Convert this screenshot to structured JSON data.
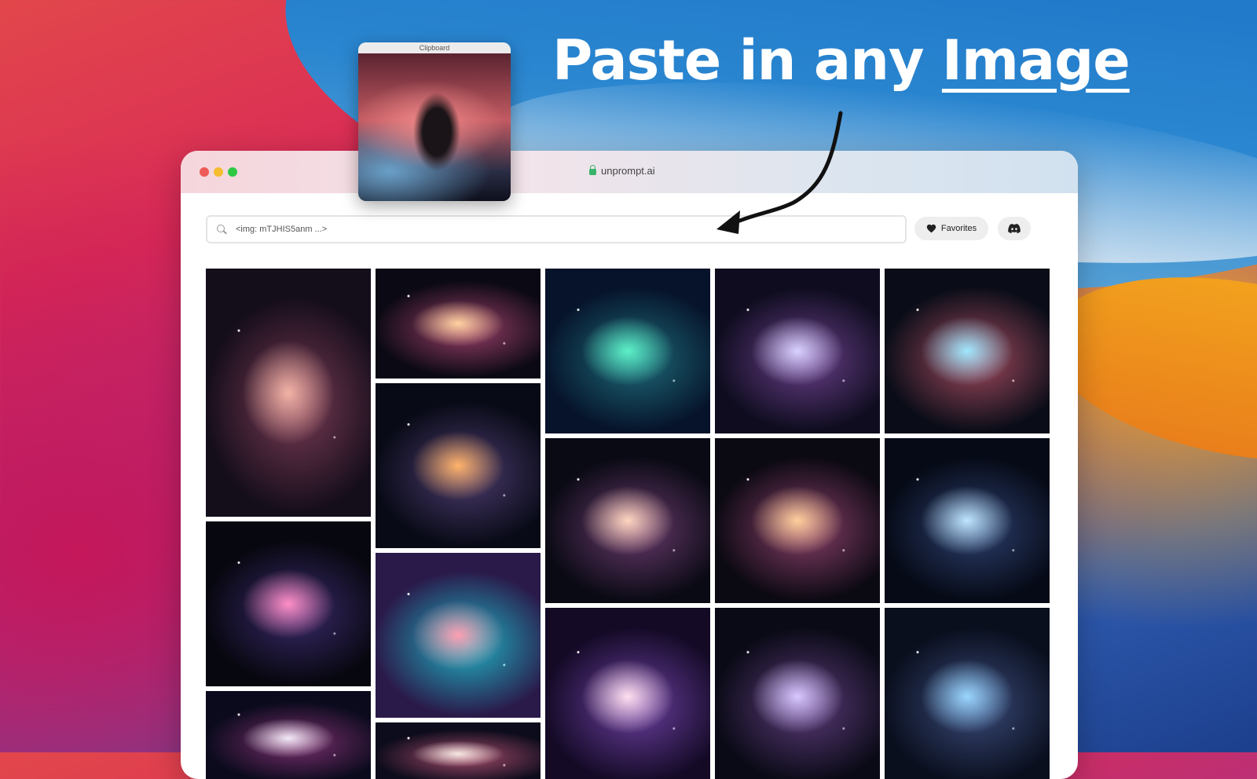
{
  "headline": {
    "prefix": "Paste in any ",
    "emphasis": "Image"
  },
  "clipboard": {
    "label": "Clipboard"
  },
  "browser": {
    "url": "unprompt.ai",
    "search": {
      "value": "<img: mTJHIS5anm ...>"
    },
    "favorites_label": "Favorites"
  },
  "colors": {
    "accent_white": "#ffffff",
    "traffic_red": "#ee5b57",
    "traffic_yellow": "#f5bd2f",
    "traffic_green": "#2ec943",
    "lock_green": "#3ab36a"
  },
  "gallery": {
    "tiles": [
      {
        "c1": "#f2b3a6",
        "c2": "#7a3b55",
        "c3": "#140d1a"
      },
      {
        "c1": "#ff8fc7",
        "c2": "#3a2a6b",
        "c3": "#07070f"
      },
      {
        "c1": "#f3eaf7",
        "c2": "#7b2f6e",
        "c3": "#0a0a1c"
      },
      {
        "c1": "#ffd2a0",
        "c2": "#9b3f6a",
        "c3": "#0b0913"
      },
      {
        "c1": "#ffb36b",
        "c2": "#4c3b6e",
        "c3": "#080a16"
      },
      {
        "c1": "#ff9fb2",
        "c2": "#1fb7c8",
        "c3": "#2a1a4a"
      },
      {
        "c1": "#f6e9e3",
        "c2": "#a44a6a",
        "c3": "#0d0c1c"
      },
      {
        "c1": "#5df0c8",
        "c2": "#1e6b7a",
        "c3": "#06132a"
      },
      {
        "c1": "#ffd6c0",
        "c2": "#6a3a6e",
        "c3": "#0a0a14"
      },
      {
        "c1": "#ffe0f0",
        "c2": "#6c3fa1",
        "c3": "#140a26"
      },
      {
        "c1": "#d9d2ff",
        "c2": "#6a3f8a",
        "c3": "#0e0c1e"
      },
      {
        "c1": "#ffcf9c",
        "c2": "#8a3f6a",
        "c3": "#0b0912"
      },
      {
        "c1": "#d8c7ff",
        "c2": "#5c3b7a",
        "c3": "#0a0a16"
      },
      {
        "c1": "#9fe8ff",
        "c2": "#a44a5e",
        "c3": "#0a0d18"
      },
      {
        "c1": "#bfe6ff",
        "c2": "#2c3f6e",
        "c3": "#060a16"
      },
      {
        "c1": "#9ad6ff",
        "c2": "#3a4a7a",
        "c3": "#0a0f1e"
      }
    ]
  }
}
